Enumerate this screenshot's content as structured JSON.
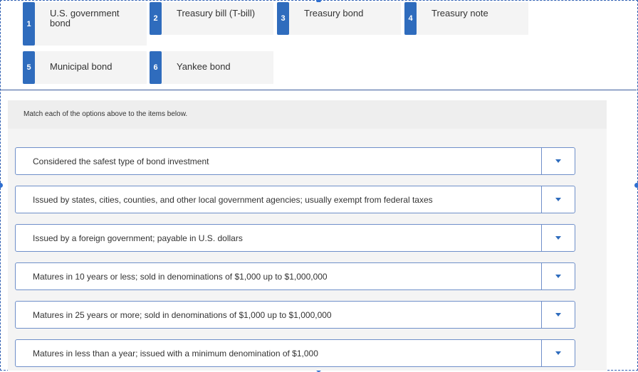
{
  "options": [
    {
      "num": "1",
      "label": "U.S. government bond"
    },
    {
      "num": "2",
      "label": "Treasury bill (T-bill)"
    },
    {
      "num": "3",
      "label": "Treasury bond"
    },
    {
      "num": "4",
      "label": "Treasury note"
    },
    {
      "num": "5",
      "label": "Municipal bond"
    },
    {
      "num": "6",
      "label": "Yankee bond"
    }
  ],
  "instructions": "Match each of the options above to the items below.",
  "items": [
    {
      "text": "Considered the safest type of bond investment"
    },
    {
      "text": "Issued by states, cities, counties, and other local government agencies; usually exempt from federal taxes"
    },
    {
      "text": "Issued by a foreign government; payable in U.S. dollars"
    },
    {
      "text": "Matures in 10 years or less; sold in denominations of $1,000 up to $1,000,000"
    },
    {
      "text": "Matures in 25 years or more; sold in denominations of $1,000 up to $1,000,000"
    },
    {
      "text": "Matures in less than a year; issued with a minimum denomination of $1,000"
    }
  ],
  "colors": {
    "accent": "#2f6cbd",
    "border": "#6f8fc9",
    "panel": "#f4f4f4"
  },
  "icons": {
    "dropdown": "chevron-down-icon"
  }
}
